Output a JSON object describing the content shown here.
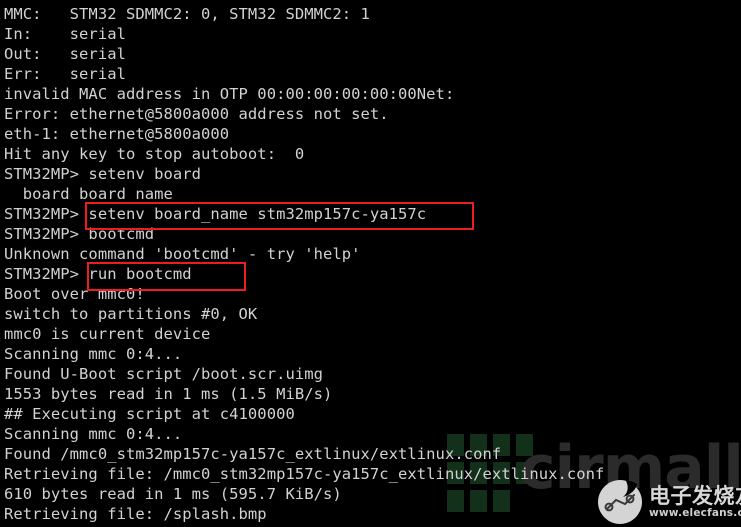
{
  "terminal": {
    "prompt": "STM32MP>",
    "background_color": "#000000",
    "text_color": "#d2d2d2",
    "highlight_color": "#ee1c1c",
    "lines": [
      "MMC:   STM32 SDMMC2: 0, STM32 SDMMC2: 1",
      "In:    serial",
      "Out:   serial",
      "Err:   serial",
      "invalid MAC address in OTP 00:00:00:00:00:00Net:",
      "Error: ethernet@5800a000 address not set.",
      "eth-1: ethernet@5800a000",
      "Hit any key to stop autoboot:  0",
      "STM32MP> setenv board",
      "  board board name",
      "STM32MP> setenv board_name stm32mp157c-ya157c",
      "STM32MP> bootcmd",
      "Unknown command 'bootcmd' - try 'help'",
      "STM32MP> run bootcmd",
      "Boot over mmc0!",
      "switch to partitions #0, OK",
      "mmc0 is current device",
      "Scanning mmc 0:4...",
      "Found U-Boot script /boot.scr.uimg",
      "1553 bytes read in 1 ms (1.5 MiB/s)",
      "## Executing script at c4100000",
      "Scanning mmc 0:4...",
      "Found /mmc0_stm32mp157c-ya157c_extlinux/extlinux.conf",
      "Retrieving file: /mmc0_stm32mp157c-ya157c_extlinux/extlinux.conf",
      "610 bytes read in 1 ms (595.7 KiB/s)",
      "Retrieving file: /splash.bmp"
    ]
  },
  "highlights": [
    {
      "id": "setenv",
      "command": "setenv board_name stm32mp157c-ya157c",
      "color": "#ee1c1c"
    },
    {
      "id": "run-bootcmd",
      "command": "run bootcmd",
      "color": "#ee1c1c"
    }
  ],
  "watermark": {
    "background_text": "cirmall",
    "background_text_color": "#2b2b2b",
    "block_color": "#13301b",
    "logo_cn": "电子发烧友",
    "logo_url": "www.elecfans.com"
  }
}
